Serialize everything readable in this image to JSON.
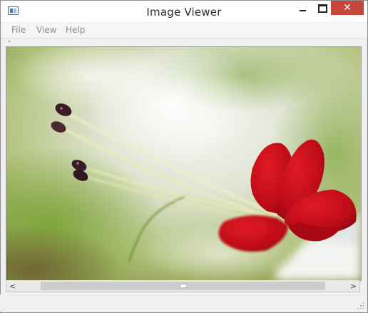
{
  "window": {
    "title": "Image Viewer",
    "close_glyph": "✕",
    "icons": {
      "app": "image-viewer-app-icon",
      "minimize": "minimize-icon",
      "maximize": "maximize-icon",
      "close": "close-icon"
    }
  },
  "menu": {
    "items": [
      "File",
      "View",
      "Help"
    ]
  },
  "image": {
    "subject": "red flower with long stamens on blurred green background",
    "colors": {
      "petal": "#c9101b",
      "stamen": "#e8ecb0",
      "anther": "#3a1a26",
      "background_green": "#8fa84a",
      "background_light": "#eef0ea"
    }
  },
  "scrollbar": {
    "left_arrow": "<",
    "right_arrow": ">",
    "position_fraction": 0.5,
    "visible_fraction": 0.93,
    "icons": {
      "left": "chevron-left-icon",
      "right": "chevron-right-icon"
    }
  }
}
